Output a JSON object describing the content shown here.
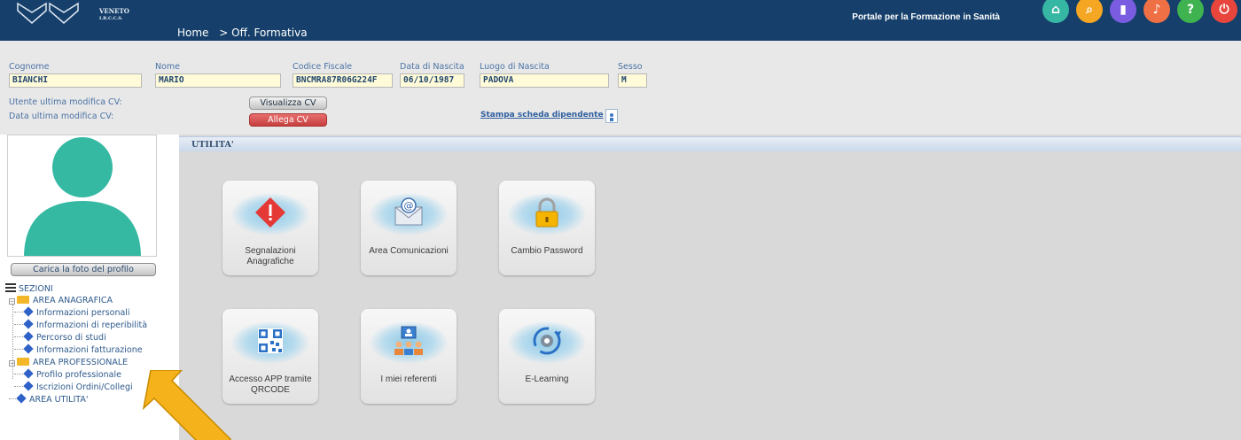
{
  "header": {
    "logo_line1": "VENETO",
    "logo_line2": "I.R.C.C.S.",
    "breadcrumb": [
      "Home",
      "> Off. Formativa"
    ],
    "portal_title": "Portale per la Formazione in Sanità",
    "icons": [
      {
        "name": "home-icon",
        "color": "#35b7a4",
        "glyph": "⌂"
      },
      {
        "name": "search-doc-icon",
        "color": "#f5a623",
        "glyph": "⌕"
      },
      {
        "name": "chat-icon",
        "color": "#7a5ce0",
        "glyph": "▮"
      },
      {
        "name": "bell-icon",
        "color": "#f07045",
        "glyph": "♪"
      },
      {
        "name": "help-icon",
        "color": "#3fb34f",
        "glyph": "?"
      },
      {
        "name": "power-icon",
        "color": "#e8463c",
        "glyph": "⏻"
      }
    ]
  },
  "user": {
    "cognome_label": "Cognome",
    "cognome": "BIANCHI",
    "nome_label": "Nome",
    "nome": "MARIO",
    "cf_label": "Codice Fiscale",
    "cf": "BNCMRA87R06G224F",
    "nascita_label": "Data di Nascita",
    "nascita": "06/10/1987",
    "luogo_label": "Luogo di Nascita",
    "luogo": "PADOVA",
    "sesso_label": "Sesso",
    "sesso": "M",
    "utente_mod_label": "Utente ultima modifica CV:",
    "data_mod_label": "Data ultima modifica CV:",
    "visualizza_cv": "Visualizza CV",
    "allega_cv": "Allega CV",
    "stampa": "Stampa scheda dipendente"
  },
  "sidebar": {
    "upload_photo": "Carica la foto del profilo",
    "sezioni": "SEZIONI",
    "area_anagrafica": "AREA ANAGRAFICA",
    "anagrafica_items": [
      "Informazioni personali",
      "Informazioni di reperibilità",
      "Percorso di studi",
      "Informazioni fatturazione"
    ],
    "area_professionale": "AREA PROFESSIONALE",
    "professionale_items": [
      "Profilo professionale",
      "Iscrizioni Ordini/Collegi"
    ],
    "area_utilita": "AREA UTILITA'"
  },
  "main": {
    "section_title": "UTILITA'",
    "cards": [
      {
        "label": "Segnalazioni Anagrafiche",
        "icon": "warning-icon"
      },
      {
        "label": "Area Comunicazioni",
        "icon": "email-icon"
      },
      {
        "label": "Cambio Password",
        "icon": "lock-icon"
      },
      {
        "label": "Accesso APP tramite QRCODE",
        "icon": "qrcode-icon"
      },
      {
        "label": "I miei referenti",
        "icon": "people-icon"
      },
      {
        "label": "E-Learning",
        "icon": "elearning-icon"
      }
    ]
  },
  "colors": {
    "header": "#16406b",
    "accent_arrow": "#f5b21a",
    "avatar": "#35b9a3"
  }
}
